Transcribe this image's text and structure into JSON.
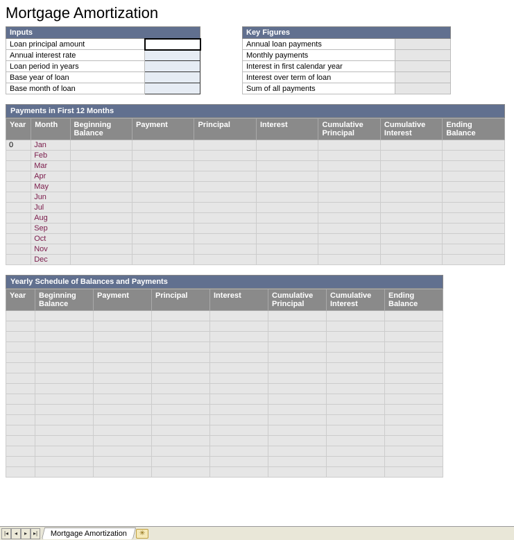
{
  "page_title": "Mortgage Amortization",
  "inputs": {
    "header": "Inputs",
    "rows": [
      {
        "label": "Loan principal amount",
        "value": "",
        "selected": true
      },
      {
        "label": "Annual interest rate",
        "value": ""
      },
      {
        "label": "Loan period in years",
        "value": ""
      },
      {
        "label": "Base year of loan",
        "value": ""
      },
      {
        "label": "Base month of loan",
        "value": ""
      }
    ]
  },
  "key_figures": {
    "header": "Key Figures",
    "rows": [
      {
        "label": "Annual loan payments",
        "value": ""
      },
      {
        "label": "Monthly payments",
        "value": ""
      },
      {
        "label": "Interest in first calendar year",
        "value": ""
      },
      {
        "label": "Interest over term of loan",
        "value": ""
      },
      {
        "label": "Sum of all payments",
        "value": ""
      }
    ]
  },
  "months_section": {
    "title": "Payments in First 12 Months",
    "columns": [
      "Year",
      "Month",
      "Beginning Balance",
      "Payment",
      "Principal",
      "Interest",
      "Cumulative Principal",
      "Cumulative Interest",
      "Ending Balance"
    ],
    "year0": "0",
    "months": [
      "Jan",
      "Feb",
      "Mar",
      "Apr",
      "May",
      "Jun",
      "Jul",
      "Aug",
      "Sep",
      "Oct",
      "Nov",
      "Dec"
    ]
  },
  "yearly_section": {
    "title": "Yearly Schedule of Balances and Payments",
    "columns": [
      "Year",
      "Beginning Balance",
      "Payment",
      "Principal",
      "Interest",
      "Cumulative Principal",
      "Cumulative Interest",
      "Ending Balance"
    ],
    "row_count": 16
  },
  "tab": {
    "name": "Mortgage Amortization"
  }
}
